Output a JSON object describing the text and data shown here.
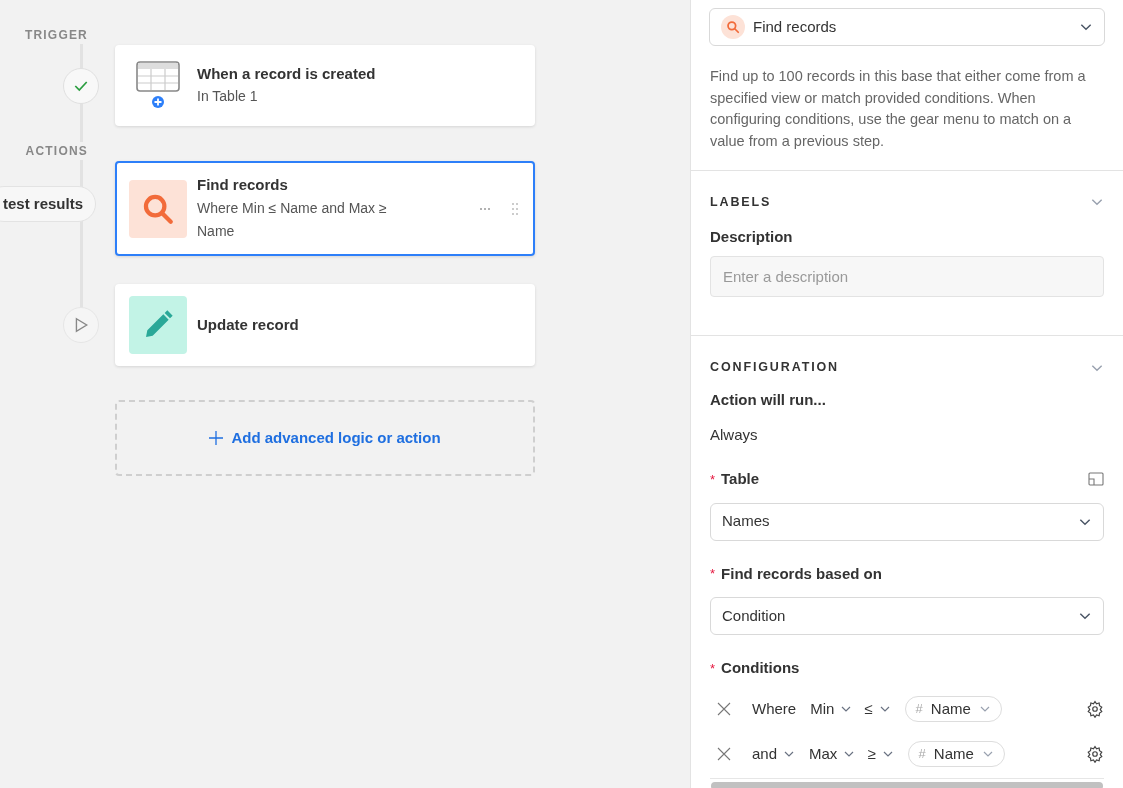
{
  "canvas": {
    "sections": [
      {
        "label": "TRIGGER",
        "steps": [
          {
            "kind": "trigger",
            "title": "When a record is created",
            "subtitle": "In Table 1",
            "show_status": true,
            "completed": true,
            "selected": false
          }
        ]
      },
      {
        "label": "ACTIONS",
        "steps": [
          {
            "kind": "find",
            "title": "Find records",
            "subtitle": "Where Min ≤ Name and Max ≥ Name",
            "show_status": false,
            "selected": true
          },
          {
            "kind": "update",
            "title": "Update record",
            "show_status": true,
            "completed": false,
            "selected": false
          }
        ]
      }
    ],
    "test_results_button": "test results",
    "add_button": "Add advanced logic or action"
  },
  "panel": {
    "action_select": "Find records",
    "description": "Find up to 100 records in this base that either come from a specified view or match provided conditions. When configuring conditions, use the gear menu to match on a value from a previous step.",
    "labels_section": {
      "title": "LABELS",
      "field_label": "Description",
      "placeholder": "Enter a description"
    },
    "configuration": {
      "title": "CONFIGURATION",
      "run_label": "Action will run...",
      "run_value": "Always",
      "table_label": "Table",
      "table_value": "Names",
      "based_on_label": "Find records based on",
      "based_on_value": "Condition",
      "conditions_label": "Conditions",
      "required_mark": "*",
      "conditions": [
        {
          "conjunction": "Where",
          "conjunction_menu": false,
          "field": "Min",
          "operator": "≤",
          "value_type_icon": "#",
          "value": "Name"
        },
        {
          "conjunction": "and",
          "conjunction_menu": true,
          "field": "Max",
          "operator": "≥",
          "value_type_icon": "#",
          "value": "Name"
        }
      ]
    }
  }
}
